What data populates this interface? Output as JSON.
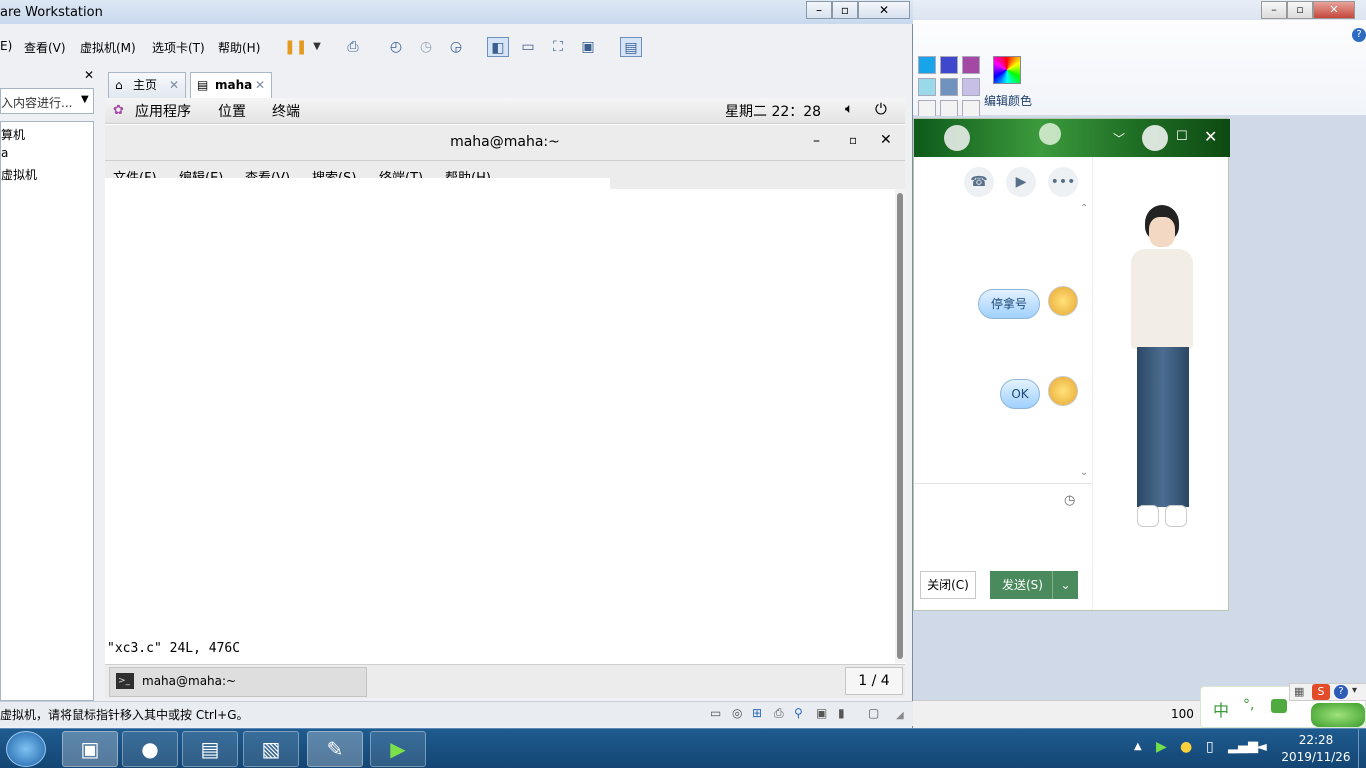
{
  "paint": {
    "edit_colors_label": "编辑颜色",
    "status_zoom": "100"
  },
  "vmware": {
    "title": "are Workstation",
    "menu": [
      "E)",
      "查看(V)",
      "虚拟机(M)",
      "选项卡(T)",
      "帮助(H)"
    ],
    "library": {
      "search_placeholder": "入内容进行...",
      "items": [
        "算机",
        "a",
        "虚拟机"
      ]
    },
    "tabs": [
      {
        "label": "主页"
      },
      {
        "label": "maha"
      }
    ],
    "status_text": "虚拟机，请将鼠标指针移入其中或按 Ctrl+G。"
  },
  "guest": {
    "topbar": {
      "applications": "应用程序",
      "places": "位置",
      "terminal": "终端",
      "clock": "星期二 22：28"
    },
    "terminal": {
      "title": "maha@maha:~",
      "menu": [
        "文件(F)",
        "编辑(E)",
        "查看(V)",
        "搜索(S)",
        "终端(T)",
        "帮助(H)"
      ],
      "status_line": "\"xc3.c\" 24L, 476C"
    },
    "taskbar": {
      "window_label": "maha@maha:~",
      "workspace": "1 / 4"
    }
  },
  "qq": {
    "messages": [
      {
        "text": "停拿号"
      },
      {
        "text": "OK"
      }
    ],
    "close_label": "关闭(C)",
    "send_label": "发送(S)"
  },
  "ime": {
    "mode": "中",
    "punct": "°,"
  },
  "system_tray": {
    "time": "22:28",
    "date": "2019/11/26"
  }
}
